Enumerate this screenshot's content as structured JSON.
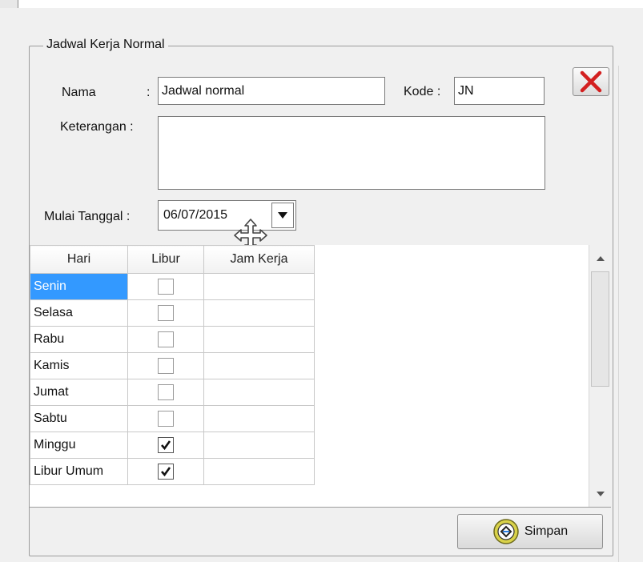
{
  "group": {
    "title": "Jadwal Kerja Normal"
  },
  "form": {
    "nama_label": "Nama",
    "nama_colon": ":",
    "nama_value": "Jadwal normal",
    "kode_label": "Kode :",
    "kode_value": "JN",
    "keterangan_label": "Keterangan :",
    "keterangan_value": "",
    "mulai_label": "Mulai Tanggal :",
    "mulai_value": "06/07/2015"
  },
  "grid": {
    "columns": [
      "Hari",
      "Libur",
      "Jam Kerja"
    ],
    "rows": [
      {
        "hari": "Senin",
        "libur": false,
        "jam": ""
      },
      {
        "hari": "Selasa",
        "libur": false,
        "jam": ""
      },
      {
        "hari": "Rabu",
        "libur": false,
        "jam": ""
      },
      {
        "hari": "Kamis",
        "libur": false,
        "jam": ""
      },
      {
        "hari": "Jumat",
        "libur": false,
        "jam": ""
      },
      {
        "hari": "Sabtu",
        "libur": false,
        "jam": ""
      },
      {
        "hari": "Minggu",
        "libur": true,
        "jam": ""
      },
      {
        "hari": "Libur Umum",
        "libur": true,
        "jam": ""
      }
    ],
    "selected_row": 0
  },
  "buttons": {
    "save_label": "Simpan"
  },
  "icons": {
    "close": "close-x-icon",
    "dropdown": "chevron-down-icon",
    "save": "save-icon",
    "cursor": "move-cursor-icon"
  },
  "colors": {
    "selection": "#3399ff",
    "close_x": "#d32020"
  }
}
